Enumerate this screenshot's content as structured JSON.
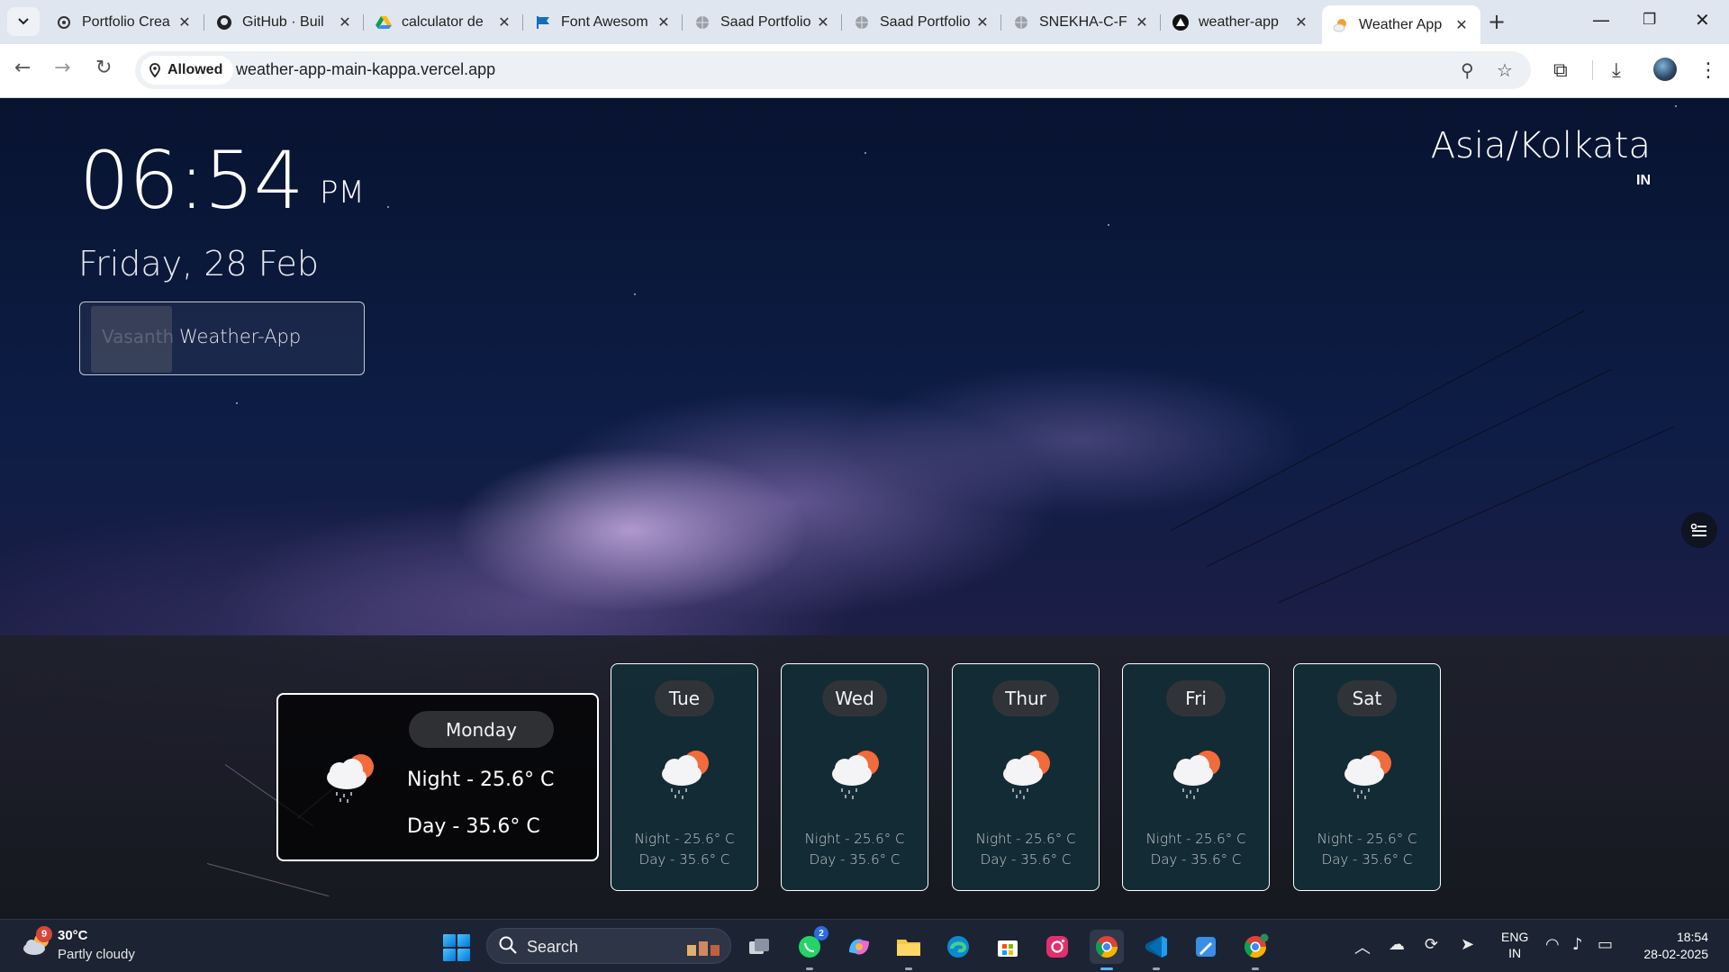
{
  "browser": {
    "tabs": [
      {
        "title": "Portfolio Crea",
        "icon": "openai-icon"
      },
      {
        "title": "GitHub · Buil",
        "icon": "github-icon"
      },
      {
        "title": "calculator de",
        "icon": "google-drive-icon"
      },
      {
        "title": "Font Awesom",
        "icon": "flag-icon"
      },
      {
        "title": "Saad Portfolio",
        "icon": "globe-icon"
      },
      {
        "title": "Saad Portfolio",
        "icon": "globe-icon"
      },
      {
        "title": "SNEKHA-C-F",
        "icon": "globe-icon"
      },
      {
        "title": "weather-app",
        "icon": "vercel-icon"
      },
      {
        "title": "Weather App",
        "icon": "weather-favicon"
      }
    ],
    "site_permission": "Allowed",
    "url": "weather-app-main-kappa.vercel.app"
  },
  "app": {
    "time": "06:54",
    "ampm": "PM",
    "date": "Friday, 28 Feb",
    "brand_name": "Vasanth",
    "brand_app": "Weather-App",
    "timezone": "Asia/Kolkata",
    "country": "IN"
  },
  "forecast": {
    "today": {
      "day": "Monday",
      "night": "Night - 25.6° C",
      "daytime": "Day - 35.6° C",
      "icon": "cloud-sun-rain-icon"
    },
    "days": [
      {
        "day": "Tue",
        "night": "Night - 25.6° C",
        "daytime": "Day - 35.6° C",
        "icon": "cloud-sun-rain-icon"
      },
      {
        "day": "Wed",
        "night": "Night - 25.6° C",
        "daytime": "Day - 35.6° C",
        "icon": "cloud-sun-rain-icon"
      },
      {
        "day": "Thur",
        "night": "Night - 25.6° C",
        "daytime": "Day - 35.6° C",
        "icon": "cloud-sun-rain-icon"
      },
      {
        "day": "Fri",
        "night": "Night - 25.6° C",
        "daytime": "Day - 35.6° C",
        "icon": "cloud-sun-rain-icon"
      },
      {
        "day": "Sat",
        "night": "Night - 25.6° C",
        "daytime": "Day - 35.6° C",
        "icon": "cloud-sun-rain-icon"
      }
    ]
  },
  "taskbar": {
    "weather_temp": "30°C",
    "weather_cond": "Partly cloudy",
    "weather_badge": "9",
    "search_label": "Search",
    "whatsapp_badge": "2",
    "lang_top": "ENG",
    "lang_bottom": "IN",
    "time": "18:54",
    "date": "28-02-2025"
  },
  "colors": {
    "accent_blue": "#0078d4",
    "card_bg": "#122d37",
    "sun": "#f26b3a"
  }
}
